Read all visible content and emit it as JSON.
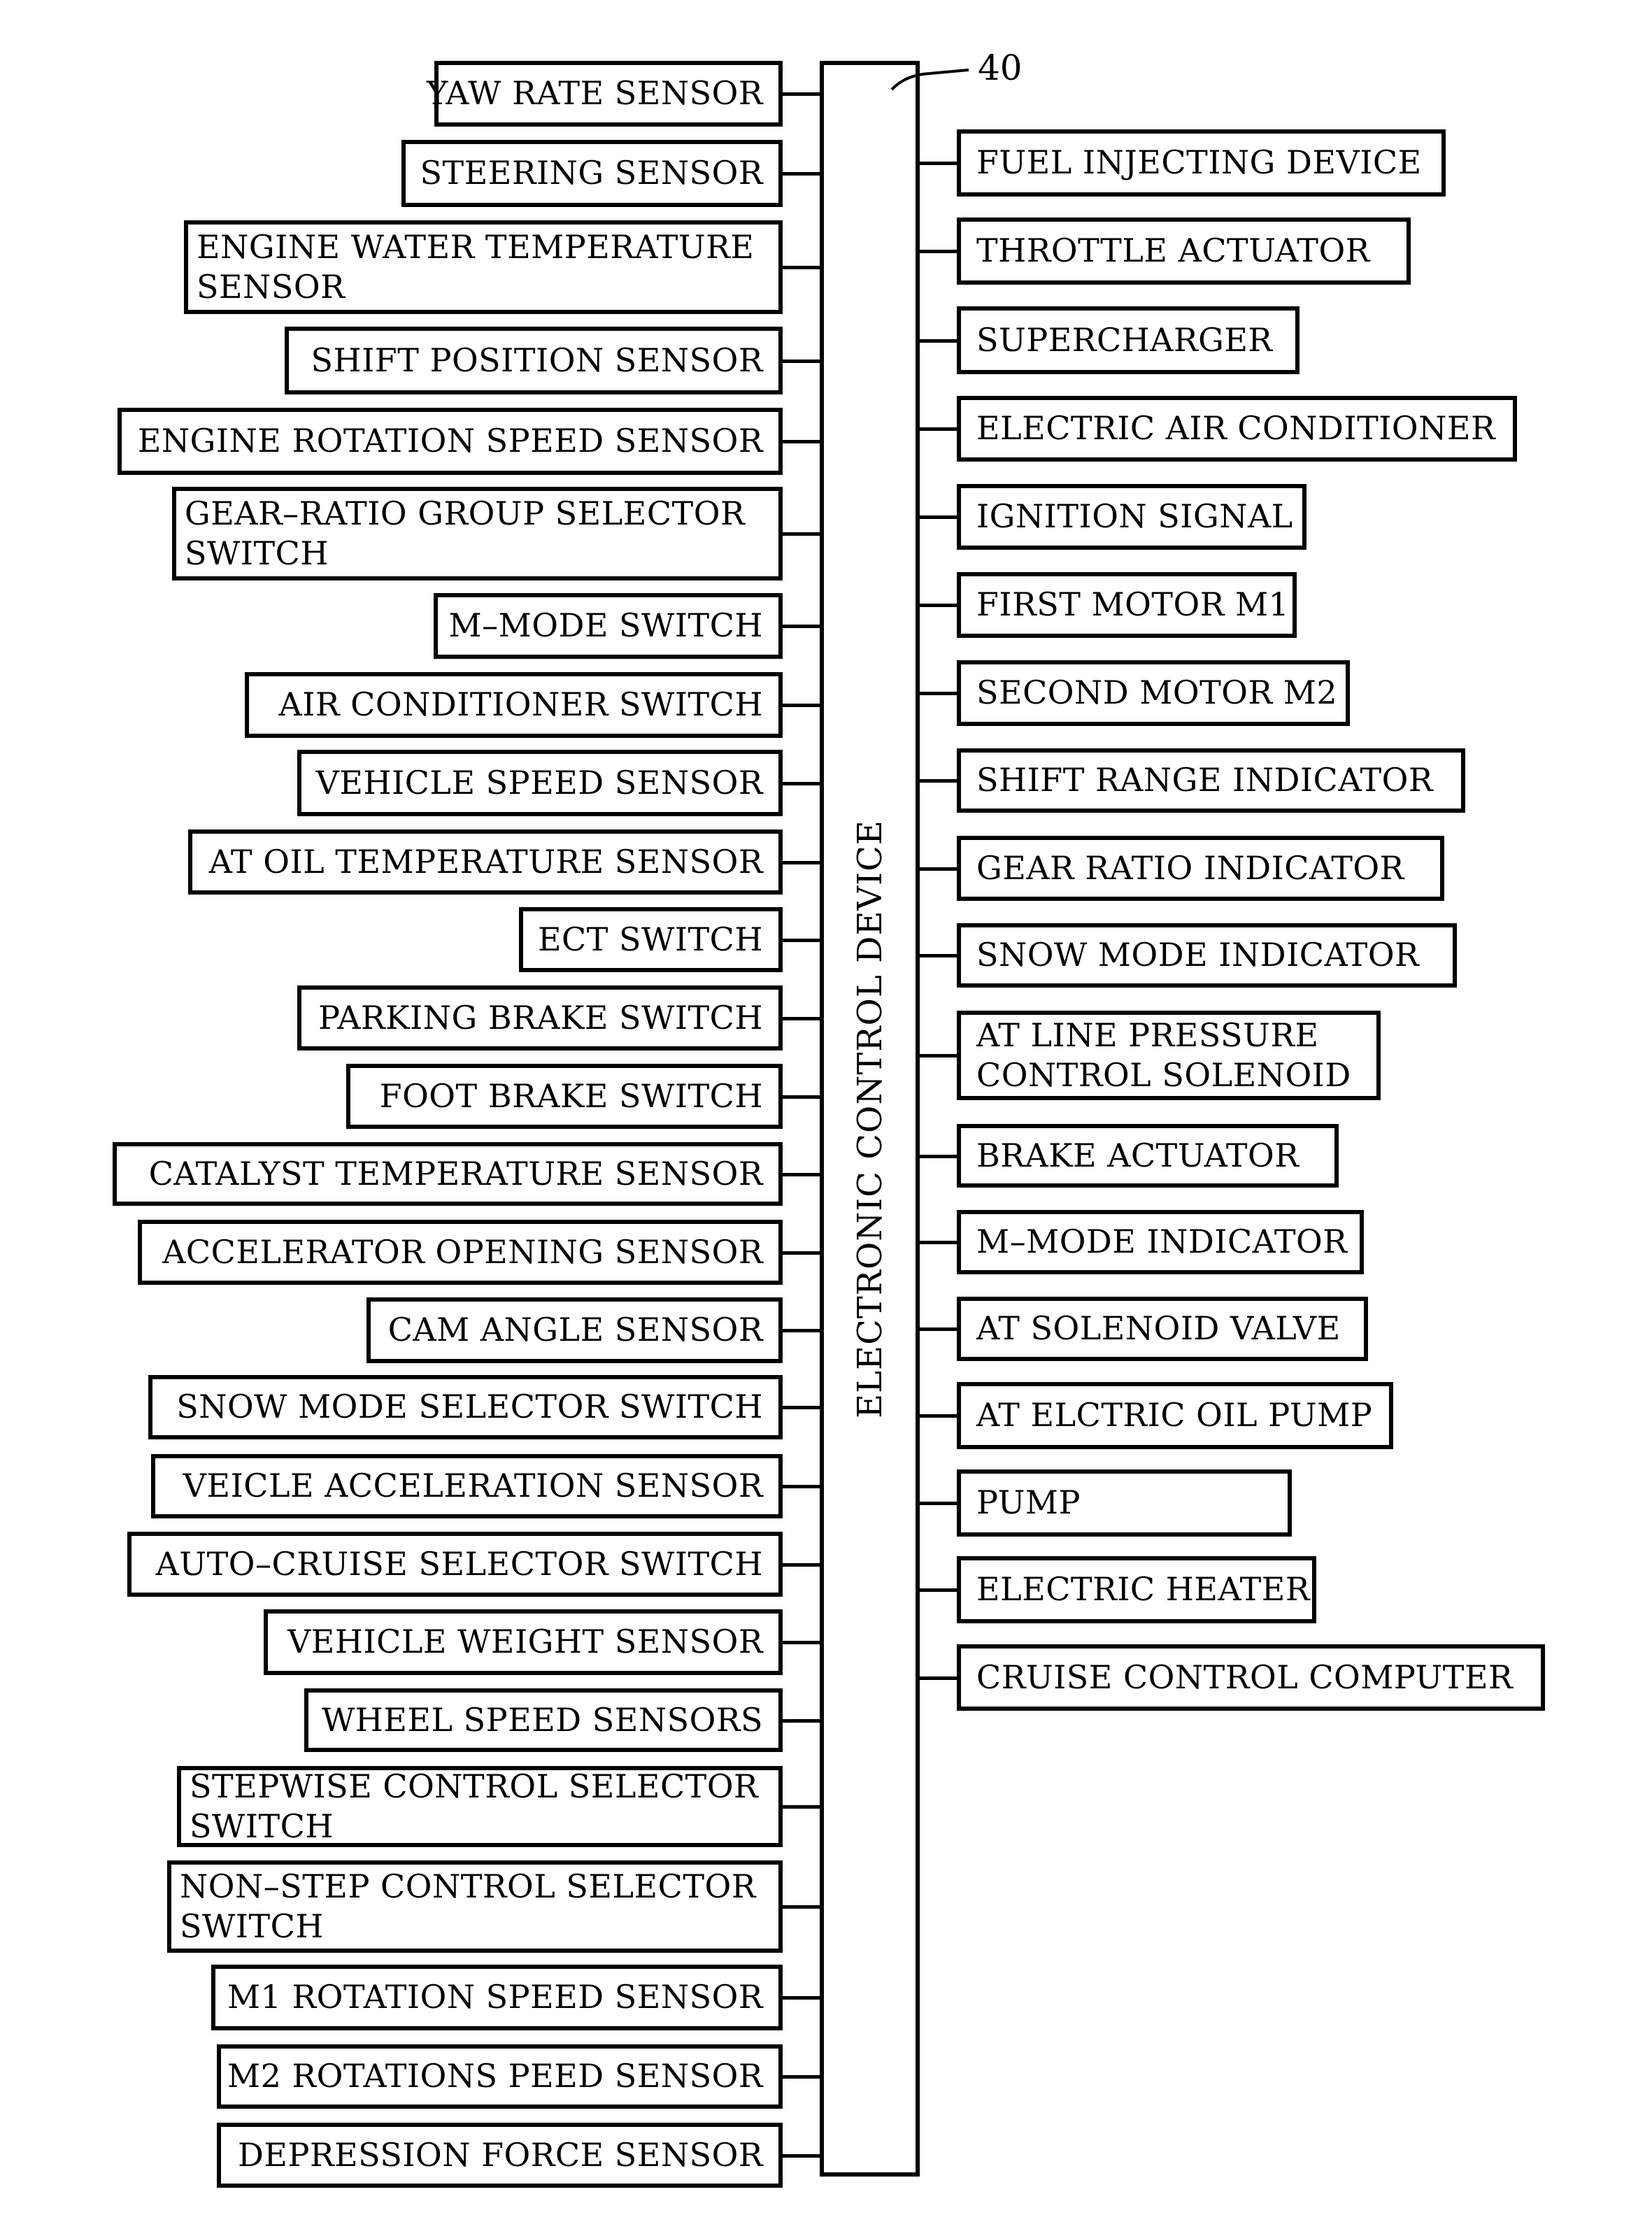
{
  "diagram": {
    "central_unit": {
      "label": "ELECTRONIC CONTROL DEVICE",
      "reference_numeral": "40"
    },
    "inputs": [
      {
        "label": "YAW RATE SENSOR"
      },
      {
        "label": "STEERING SENSOR"
      },
      {
        "label": "ENGINE WATER TEMPERATURE SENSOR",
        "lines": [
          "ENGINE WATER TEMPERATURE",
          "SENSOR"
        ]
      },
      {
        "label": "SHIFT POSITION SENSOR"
      },
      {
        "label": "ENGINE ROTATION SPEED SENSOR"
      },
      {
        "label": "GEAR-RATIO GROUP SELECTOR SWITCH",
        "lines": [
          "GEAR–RATIO GROUP SELECTOR",
          "SWITCH"
        ]
      },
      {
        "label": "M–MODE SWITCH"
      },
      {
        "label": "AIR CONDITIONER SWITCH"
      },
      {
        "label": "VEHICLE SPEED SENSOR"
      },
      {
        "label": "AT OIL TEMPERATURE SENSOR"
      },
      {
        "label": "ECT SWITCH"
      },
      {
        "label": "PARKING BRAKE SWITCH"
      },
      {
        "label": "FOOT BRAKE SWITCH"
      },
      {
        "label": "CATALYST TEMPERATURE SENSOR"
      },
      {
        "label": "ACCELERATOR OPENING SENSOR"
      },
      {
        "label": "CAM ANGLE SENSOR"
      },
      {
        "label": "SNOW MODE SELECTOR SWITCH"
      },
      {
        "label": "VEICLE ACCELERATION SENSOR"
      },
      {
        "label": "AUTO–CRUISE SELECTOR SWITCH"
      },
      {
        "label": "VEHICLE WEIGHT SENSOR"
      },
      {
        "label": "WHEEL SPEED SENSORS"
      },
      {
        "label": "STEPWISE CONTROL SELECTOR SWITCH",
        "lines": [
          "STEPWISE CONTROL SELECTOR",
          "SWITCH"
        ]
      },
      {
        "label": "NON-STEP CONTROL SELECTOR SWITCH",
        "lines": [
          "NON–STEP CONTROL SELECTOR",
          "SWITCH"
        ]
      },
      {
        "label": "M1 ROTATION SPEED SENSOR"
      },
      {
        "label": "M2 ROTATIONS PEED SENSOR"
      },
      {
        "label": "DEPRESSION FORCE SENSOR"
      }
    ],
    "outputs": [
      {
        "label": "FUEL INJECTING DEVICE"
      },
      {
        "label": "THROTTLE ACTUATOR"
      },
      {
        "label": "SUPERCHARGER"
      },
      {
        "label": "ELECTRIC AIR CONDITIONER"
      },
      {
        "label": "IGNITION SIGNAL"
      },
      {
        "label": "FIRST MOTOR M1"
      },
      {
        "label": "SECOND MOTOR M2"
      },
      {
        "label": "SHIFT RANGE INDICATOR"
      },
      {
        "label": "GEAR RATIO INDICATOR"
      },
      {
        "label": "SNOW MODE INDICATOR"
      },
      {
        "label": "AT LINE PRESSURE CONTROL SOLENOID",
        "lines": [
          "AT LINE PRESSURE",
          "CONTROL SOLENOID"
        ]
      },
      {
        "label": "BRAKE ACTUATOR"
      },
      {
        "label": "M–MODE INDICATOR"
      },
      {
        "label": "AT SOLENOID VALVE"
      },
      {
        "label": "AT ELCTRIC OIL PUMP"
      },
      {
        "label": "PUMP"
      },
      {
        "label": "ELECTRIC HEATER"
      },
      {
        "label": "CRUISE CONTROL COMPUTER"
      }
    ]
  }
}
